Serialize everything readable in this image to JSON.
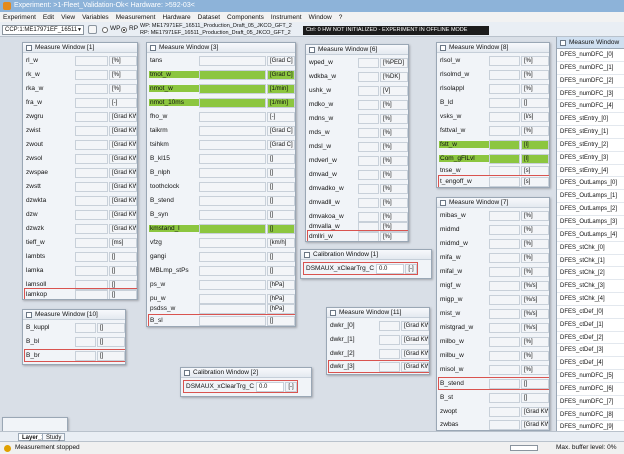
{
  "titlebar": {
    "title": "Experiment: >1-Fleet_Validation-Ok< Hardware: >592-03<"
  },
  "menu": [
    "Experiment",
    "Edit",
    "View",
    "Variables",
    "Measurement",
    "Hardware",
    "Dataset",
    "Components",
    "Instrument",
    "Window",
    "?"
  ],
  "toolbar": {
    "ccp": "CCP:1:ME17971EF_16511",
    "wp_label": "WP",
    "rp_label": "RP",
    "wp_text": "WP: ME17971EF_16511_Production_Draft_05_JKCO_GFT_2",
    "rp_text": "RP: ME17971EF_16511_Production_Draft_05_JKCO_GFT_2",
    "status": "Ctrl: 0  HW NOT INITIALIZED - EXPERIMENT IN OFFLINE MODE"
  },
  "windows": {
    "mw1": {
      "title": "Measure Window [1]",
      "rows": [
        {
          "name": "rl_w",
          "value": "",
          "unit": "[%]"
        },
        {
          "name": "rk_w",
          "value": "",
          "unit": "[%]"
        },
        {
          "name": "rka_w",
          "value": "",
          "unit": "[%]"
        },
        {
          "name": "fra_w",
          "value": "",
          "unit": "[-]"
        },
        {
          "name": "zwgru",
          "value": "",
          "unit": "[Grad KW]"
        },
        {
          "name": "zwist",
          "value": "",
          "unit": "[Grad KW]"
        },
        {
          "name": "zwout",
          "value": "",
          "unit": "[Grad KW]"
        },
        {
          "name": "zwsol",
          "value": "",
          "unit": "[Grad KW]"
        },
        {
          "name": "zwspae",
          "value": "",
          "unit": "[Grad KW]"
        },
        {
          "name": "zwstt",
          "value": "",
          "unit": "[Grad KW]"
        },
        {
          "name": "dzwkta",
          "value": "",
          "unit": "[Grad KW]"
        },
        {
          "name": "dzw",
          "value": "",
          "unit": "[Grad KW]"
        },
        {
          "name": "dzwzk",
          "value": "",
          "unit": "[Grad KW]"
        },
        {
          "name": "tieff_w",
          "value": "",
          "unit": "[ms]"
        },
        {
          "name": "lambts",
          "value": "",
          "unit": "[]"
        },
        {
          "name": "lamka",
          "value": "",
          "unit": "[]"
        },
        {
          "name": "lamsoll",
          "value": "",
          "unit": "[]"
        },
        {
          "name": "lamkop",
          "value": "",
          "unit": "[]"
        }
      ]
    },
    "mw3": {
      "title": "Measure Window [3]",
      "rows": [
        {
          "name": "tans",
          "value": "",
          "unit": "[Grad C]"
        },
        {
          "name": "tmot_w",
          "value": "",
          "unit": "[Grad C]"
        },
        {
          "name": "nmot_w",
          "value": "",
          "unit": "[1/min]"
        },
        {
          "name": "nmot_10ms",
          "value": "",
          "unit": "[1/min]"
        },
        {
          "name": "fho_w",
          "value": "",
          "unit": "[-]"
        },
        {
          "name": "taikrm",
          "value": "",
          "unit": "[Grad C]"
        },
        {
          "name": "tsihkm",
          "value": "",
          "unit": "[Grad C]"
        },
        {
          "name": "B_kl15",
          "value": "",
          "unit": "[]"
        },
        {
          "name": "B_nlph",
          "value": "",
          "unit": "[]"
        },
        {
          "name": "toothclock",
          "value": "",
          "unit": "[]"
        },
        {
          "name": "B_stend",
          "value": "",
          "unit": "[]"
        },
        {
          "name": "B_syn",
          "value": "",
          "unit": "[]"
        },
        {
          "name": "kmstand_l",
          "value": "",
          "unit": "[]"
        },
        {
          "name": "vfzg",
          "value": "",
          "unit": "[km/h]"
        },
        {
          "name": "gangi",
          "value": "",
          "unit": "[]"
        },
        {
          "name": "MBLmp_stPs",
          "value": "",
          "unit": "[]"
        },
        {
          "name": "ps_w",
          "value": "",
          "unit": "[hPa]"
        },
        {
          "name": "pu_w",
          "value": "",
          "unit": "[hPa]"
        },
        {
          "name": "psdss_w",
          "value": "",
          "unit": "[hPa]"
        },
        {
          "name": "B_sl",
          "value": "",
          "unit": "[]"
        }
      ]
    },
    "mw6": {
      "title": "Measure Window [6]",
      "rows": [
        {
          "name": "wped_w",
          "value": "",
          "unit": "[%PED]"
        },
        {
          "name": "wdkba_w",
          "value": "",
          "unit": "[%DK]"
        },
        {
          "name": "ushk_w",
          "value": "",
          "unit": "[V]"
        },
        {
          "name": "mdko_w",
          "value": "",
          "unit": "[%]"
        },
        {
          "name": "mdns_w",
          "value": "",
          "unit": "[%]"
        },
        {
          "name": "mds_w",
          "value": "",
          "unit": "[%]"
        },
        {
          "name": "mdsl_w",
          "value": "",
          "unit": "[%]"
        },
        {
          "name": "mdverl_w",
          "value": "",
          "unit": "[%]"
        },
        {
          "name": "dmvad_w",
          "value": "",
          "unit": "[%]"
        },
        {
          "name": "dmvadko_w",
          "value": "",
          "unit": "[%]"
        },
        {
          "name": "dmvadll_w",
          "value": "",
          "unit": "[%]"
        },
        {
          "name": "dmvakoa_w",
          "value": "",
          "unit": "[%]"
        },
        {
          "name": "dmvalla_w",
          "value": "",
          "unit": "[%]"
        },
        {
          "name": "dmllri_w",
          "value": "",
          "unit": "[%]"
        }
      ]
    },
    "mw8": {
      "title": "Measure Window [8]",
      "rows": [
        {
          "name": "rlsol_w",
          "value": "",
          "unit": "[%]"
        },
        {
          "name": "rlsolmd_w",
          "value": "",
          "unit": "[%]"
        },
        {
          "name": "rlsolappl",
          "value": "",
          "unit": "[%]"
        },
        {
          "name": "B_ld",
          "value": "",
          "unit": "[]"
        },
        {
          "name": "vsks_w",
          "value": "",
          "unit": "[l/s]"
        },
        {
          "name": "fsttval_w",
          "value": "",
          "unit": "[%]"
        },
        {
          "name": "fstt_w",
          "value": "",
          "unit": "[l]"
        },
        {
          "name": "Com_gFlLvl",
          "value": "",
          "unit": "[l]"
        },
        {
          "name": "tnse_w",
          "value": "",
          "unit": "[s]"
        },
        {
          "name": "t_engoff_w",
          "value": "",
          "unit": "[s]"
        }
      ]
    },
    "mw7": {
      "title": "Measure Window [7]",
      "rows": [
        {
          "name": "mibas_w",
          "value": "",
          "unit": "[%]"
        },
        {
          "name": "midmd",
          "value": "",
          "unit": "[%]"
        },
        {
          "name": "midmd_w",
          "value": "",
          "unit": "[%]"
        },
        {
          "name": "mifa_w",
          "value": "",
          "unit": "[%]"
        },
        {
          "name": "mifal_w",
          "value": "",
          "unit": "[%]"
        },
        {
          "name": "migf_w",
          "value": "",
          "unit": "[%/s]"
        },
        {
          "name": "migp_w",
          "value": "",
          "unit": "[%/s]"
        },
        {
          "name": "mist_w",
          "value": "",
          "unit": "[%/s]"
        },
        {
          "name": "mistgrad_w",
          "value": "",
          "unit": "[%/s]"
        },
        {
          "name": "milbo_w",
          "value": "",
          "unit": "[%]"
        },
        {
          "name": "milbu_w",
          "value": "",
          "unit": "[%]"
        },
        {
          "name": "misol_w",
          "value": "",
          "unit": "[%]"
        },
        {
          "name": "B_stend",
          "value": "",
          "unit": "[]"
        },
        {
          "name": "B_st",
          "value": "",
          "unit": "[]"
        },
        {
          "name": "zwopt",
          "value": "",
          "unit": "[Grad KW]"
        },
        {
          "name": "zwbas",
          "value": "",
          "unit": "[Grad KW]"
        }
      ]
    },
    "mw10": {
      "title": "Measure Window [10]",
      "rows": [
        {
          "name": "B_kuppl",
          "value": "",
          "unit": "[]"
        },
        {
          "name": "B_bl",
          "value": "",
          "unit": "[]"
        },
        {
          "name": "B_br",
          "value": "",
          "unit": "[]"
        }
      ]
    },
    "mw11": {
      "title": "Measure Window [11]",
      "rows": [
        {
          "name": "dwkr_[0]",
          "value": "",
          "unit": "[Grad KW]"
        },
        {
          "name": "dwkr_[1]",
          "value": "",
          "unit": "[Grad KW]"
        },
        {
          "name": "dwkr_[2]",
          "value": "",
          "unit": "[Grad KW]"
        },
        {
          "name": "dwkr_[3]",
          "value": "",
          "unit": "[Grad KW]"
        }
      ]
    },
    "cw1": {
      "title": "Calibration Window [1]",
      "name": "DSMAUX_xClearTrg_C",
      "value": "0.0",
      "unit": "[-]"
    },
    "cw2": {
      "title": "Calibration Window [2]",
      "name": "DSMAUX_xClearTrg_C",
      "value": "0.0",
      "unit": "[-]"
    }
  },
  "right_panel": {
    "title": "Measure Window",
    "items": [
      "DFES_numDFC_[0]",
      "DFES_numDFC_[1]",
      "DFES_numDFC_[2]",
      "DFES_numDFC_[3]",
      "DFES_numDFC_[4]",
      "DFES_stEntry_[0]",
      "DFES_stEntry_[1]",
      "DFES_stEntry_[2]",
      "DFES_stEntry_[3]",
      "DFES_stEntry_[4]",
      "DFES_OutLamps_[0]",
      "DFES_OutLamps_[1]",
      "DFES_OutLamps_[2]",
      "DFES_OutLamps_[3]",
      "DFES_OutLamps_[4]",
      "DFES_stChk_[0]",
      "DFES_stChk_[1]",
      "DFES_stChk_[2]",
      "DFES_stChk_[3]",
      "DFES_stChk_[4]",
      "DFES_ctDef_[0]",
      "DFES_ctDef_[1]",
      "DFES_ctDef_[2]",
      "DFES_ctDef_[3]",
      "DFES_ctDef_[4]",
      "DFES_numDFC_[5]",
      "DFES_numDFC_[6]",
      "DFES_numDFC_[7]",
      "DFES_numDFC_[8]",
      "DFES_numDFC_[9]"
    ]
  },
  "tabs": [
    "Layer_1",
    "Study"
  ],
  "status": {
    "message": "Measurement stopped",
    "buffer": "Max. buffer level: 0%",
    "buffer_level": 0
  },
  "colors": {
    "highlight_green": "#8cc63f",
    "selection_red": "#d9534f",
    "title_blue": "#8db3d9"
  }
}
